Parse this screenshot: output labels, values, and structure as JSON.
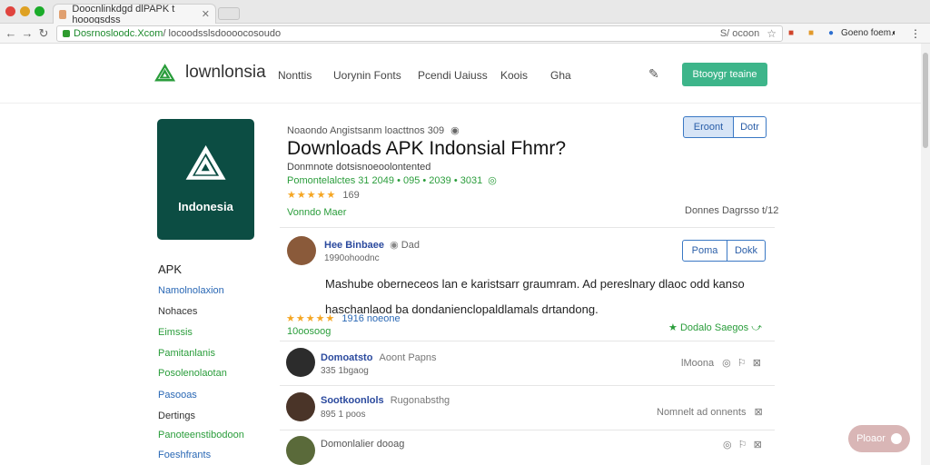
{
  "browser": {
    "tab_title": "Doocnlinkdgd dlPAPK t hooogsdss",
    "url_domain": "Dosrnosloodc.Xcom",
    "url_path": "/ locoodsslsdoooocosoudo",
    "url_search_hint": "S/ ocoon",
    "ext_label": "Goeno foem.",
    "colors": {
      "dot_red": "#e0443e",
      "dot_yellow": "#dea123",
      "dot_green": "#1aab29"
    }
  },
  "site": {
    "logo_text": "lownlonsia",
    "nav": [
      "Nonttis",
      "Uorynin Fonts",
      "Pcendi Uaiuss",
      "Koois",
      "Gha"
    ],
    "cta_label": "Btooygr teaine",
    "accent": "#3db58a"
  },
  "app": {
    "icon_word": "Indonesia",
    "breadcrumb": "Noaondo Angistsanm loacttnos 309",
    "title": "Downloads APK Indonsial Fhmr?",
    "subtitle": "Donmnote dotsisnoeoolontented",
    "version_line": "Pomontelalctes 31  2049 • 095 • 2039 • 3031",
    "rating_count": "169",
    "vendor_link": "Vonndo Maer",
    "btn_primary": "Eroont",
    "btn_secondary": "Dotr",
    "downloads_right": "Donnes Dagrsso t/12"
  },
  "sidebar": {
    "title": "APK",
    "items": [
      {
        "label": "Namolnolaxion",
        "color": "#2a68b5"
      },
      {
        "label": "Nohaces",
        "color": "#333333"
      },
      {
        "label": "Eimssis",
        "color": "#2a9d3b"
      },
      {
        "label": "Pamitanlanis",
        "color": "#2a9d3b"
      },
      {
        "label": "Posolenolaotan",
        "color": "#2a9d3b"
      },
      {
        "label": "Pasooas",
        "color": "#2a68b5"
      },
      {
        "label": "Dertings",
        "color": "#333333"
      },
      {
        "label": "Panoteenstibodoon",
        "color": "#2a9d3b"
      },
      {
        "label": "Foeshfrants",
        "color": "#2a68b5"
      }
    ]
  },
  "review_main": {
    "name": "Hee Binbaee",
    "badge": "Dad",
    "sub": "1990ohoodnc",
    "body": "Mashube oberneceos lan e karistsarr graumram. Ad pereslnary dlaoc odd kanso haschanlaod ba dondanienclopaldlamals drtandong.",
    "btn_a": "Poma",
    "btn_b": "Dokk",
    "rating_text": "1916 noeone",
    "rating_sub": "10oosoog",
    "action_label": "Dodalo Saegos"
  },
  "reviews": [
    {
      "name": "Domoatsto",
      "name_extra": "Aoont Papns",
      "sub": "335 1bgaog",
      "right": "lMoona"
    },
    {
      "name": "Sootkoonlols",
      "name_extra": "Rugonabsthg",
      "sub": "895 1 poos",
      "right": "Nomnelt ad onnents"
    },
    {
      "name": "Domonlalier dooag",
      "name_extra": "",
      "sub": "",
      "right": ""
    }
  ],
  "fab_label": "Ploaor"
}
